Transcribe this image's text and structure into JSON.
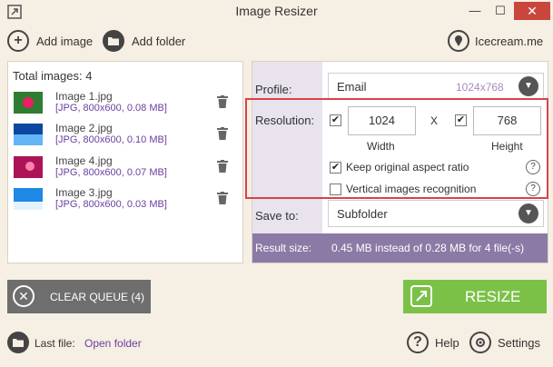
{
  "window": {
    "title": "Image Resizer",
    "minimize_glyph": "—",
    "maximize_glyph": "☐",
    "close_glyph": "✕"
  },
  "toolbar": {
    "add_image_label": "Add image",
    "add_image_icon": "plus",
    "add_folder_label": "Add folder",
    "add_folder_icon": "folder",
    "icecream_label": "Icecream.me",
    "icecream_icon": "icecream"
  },
  "file_list": {
    "total_label": "Total images: 4",
    "items": [
      {
        "name": "Image 1.jpg",
        "meta": "[JPG, 800x600, 0.08 MB]",
        "thumb_color": "#2e7d32"
      },
      {
        "name": "Image 2.jpg",
        "meta": "[JPG, 800x600, 0.10 MB]",
        "thumb_color": "#1565c0"
      },
      {
        "name": "Image 4.jpg",
        "meta": "[JPG, 800x600, 0.07 MB]",
        "thumb_color": "#c2185b"
      },
      {
        "name": "Image 3.jpg",
        "meta": "[JPG, 800x600, 0.03 MB]",
        "thumb_color": "#1e88e5"
      }
    ]
  },
  "settings": {
    "profile_label": "Profile:",
    "profile_value": "Email",
    "profile_dims": "1024x768",
    "resolution_label": "Resolution:",
    "width_value": "1024",
    "width_checked": true,
    "width_label": "Width",
    "x_label": "X",
    "height_value": "768",
    "height_checked": true,
    "height_label": "Height",
    "keep_aspect_label": "Keep original aspect ratio",
    "keep_aspect_checked": true,
    "vertical_label": "Vertical images recognition",
    "vertical_checked": false,
    "help_glyph": "?",
    "saveto_label": "Save to:",
    "saveto_value": "Subfolder",
    "result_label": "Result size:",
    "result_text": "0.45 MB instead of 0.28 MB for 4 file(-s)",
    "dropdown_glyph": "▼",
    "check_glyph": "✔"
  },
  "actions": {
    "clear_queue_label": "CLEAR QUEUE (4)",
    "clear_icon_glyph": "✕",
    "resize_label": "RESIZE"
  },
  "footer": {
    "last_file_label": "Last file:",
    "open_folder_label": "Open folder",
    "help_label": "Help",
    "help_glyph": "?",
    "settings_label": "Settings"
  },
  "colors": {
    "background": "#f6efe3",
    "accent_purple": "#6b3fa0",
    "result_bar": "#8b7aa5",
    "resize_green": "#7bc148",
    "clear_gray": "#6e6e6e",
    "highlight_red": "#d9424a",
    "close_red": "#c9463d"
  }
}
